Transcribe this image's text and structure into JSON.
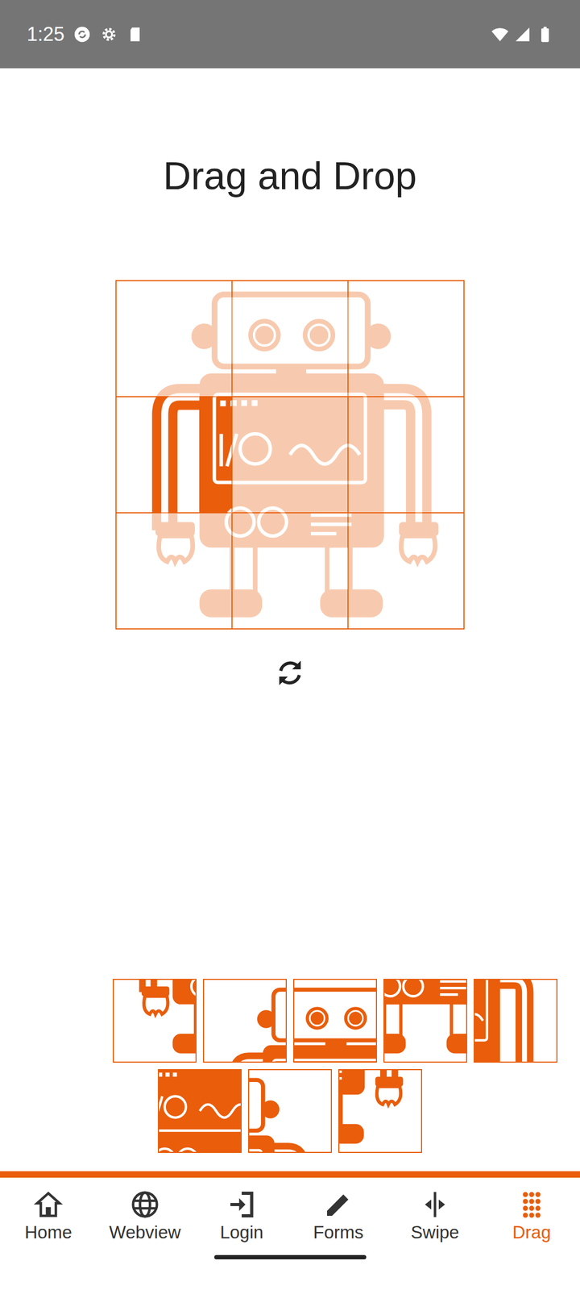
{
  "status_bar": {
    "time": "1:25"
  },
  "title": "Drag and Drop",
  "board": {
    "cells": [
      {
        "filled": false
      },
      {
        "filled": false
      },
      {
        "filled": false
      },
      {
        "filled": true
      },
      {
        "filled": false
      },
      {
        "filled": false
      },
      {
        "filled": false
      },
      {
        "filled": false
      },
      {
        "filled": false
      }
    ]
  },
  "tray": {
    "pieces": [
      6,
      0,
      1,
      7,
      5,
      4,
      2,
      8
    ]
  },
  "tab_bar": {
    "tabs": [
      {
        "label": "Home",
        "selected": false
      },
      {
        "label": "Webview",
        "selected": false
      },
      {
        "label": "Login",
        "selected": false
      },
      {
        "label": "Forms",
        "selected": false
      },
      {
        "label": "Swipe",
        "selected": false
      },
      {
        "label": "Drag",
        "selected": true
      }
    ]
  }
}
